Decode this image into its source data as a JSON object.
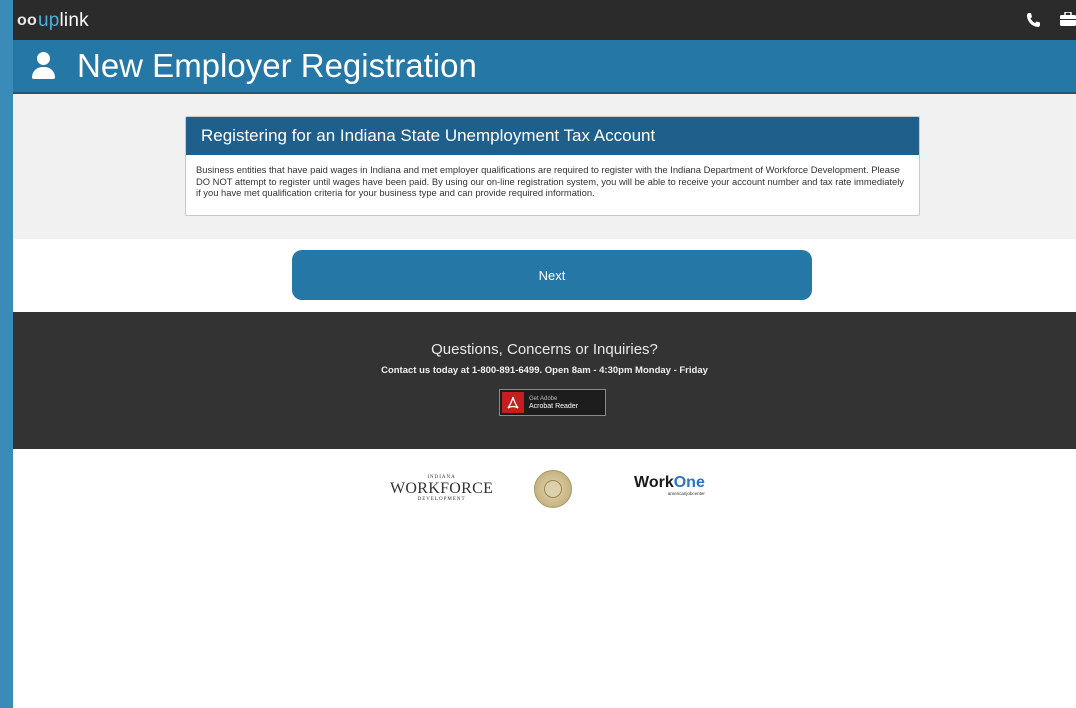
{
  "app": {
    "logo_mark": "oo",
    "logo_up": "up",
    "logo_link": "link"
  },
  "header": {
    "title": "New Employer Registration"
  },
  "card": {
    "title": "Registering for an Indiana State Unemployment Tax Account",
    "body": "Business entities that have paid wages in Indiana and met employer qualifications are required to register with the Indiana Department of Workforce Development. Please DO NOT attempt to register until wages have been paid. By using our on-line registration system, you will be able to receive your account number and tax rate immediately if you have met qualification criteria for your business type and can provide required information."
  },
  "actions": {
    "next_label": "Next"
  },
  "footer": {
    "question": "Questions, Concerns or Inquiries?",
    "contact": "Contact us today at 1-800-891-6499. Open 8am - 4:30pm Monday - Friday",
    "acrobat_line1": "Get Adobe",
    "acrobat_line2": "Acrobat Reader"
  },
  "partners": {
    "workforce_top": "INDIANA",
    "workforce_main": "WORKFORCE",
    "workforce_bottom": "DEVELOPMENT",
    "workone_work": "Work",
    "workone_one": "One",
    "workone_sub": "americanjobcenter"
  },
  "icons": {
    "phone": "phone-icon",
    "briefcase": "briefcase-icon",
    "user": "user-icon",
    "acrobat": "acrobat-icon",
    "seal": "state-seal-icon"
  },
  "colors": {
    "topbar": "#2b2b2b",
    "titlebar": "#2577a6",
    "card_header": "#1f5f8c",
    "button": "#2577a6",
    "footer": "#333333"
  }
}
